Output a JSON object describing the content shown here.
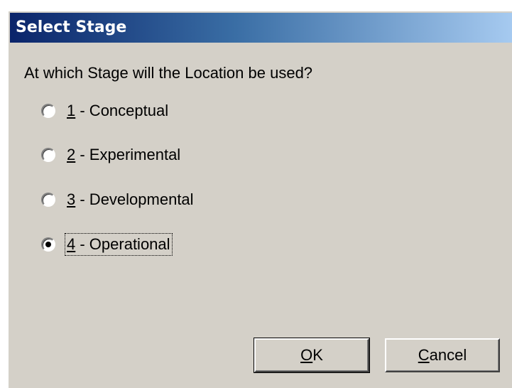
{
  "dialog": {
    "title": "Select Stage",
    "question": "At which Stage will the Location be used?"
  },
  "options": [
    {
      "key": "1",
      "rest": " - Conceptual",
      "selected": false
    },
    {
      "key": "2",
      "rest": " - Experimental",
      "selected": false
    },
    {
      "key": "3",
      "rest": " - Developmental",
      "selected": false
    },
    {
      "key": "4",
      "rest": " - Operational",
      "selected": true
    }
  ],
  "buttons": {
    "ok": {
      "accel": "O",
      "rest": "K"
    },
    "cancel": {
      "accel": "C",
      "rest": "ancel"
    }
  },
  "colors": {
    "title_gradient_start": "#0a246a",
    "title_gradient_end": "#a6caf0",
    "dialog_face": "#d4d0c8"
  }
}
